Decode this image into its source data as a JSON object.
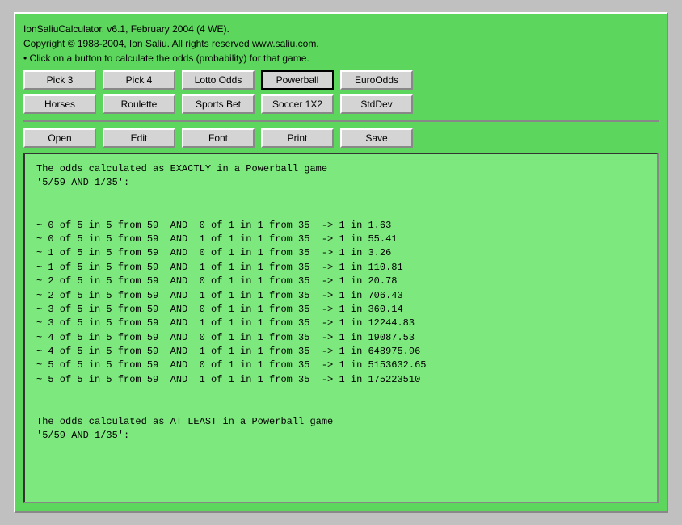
{
  "app": {
    "title_line1": "IonSaliuCalculator, v6.1, February 2004 (4 WE).",
    "title_line2": "Copyright © 1988-2004, Ion Saliu. All rights reserved www.saliu.com.",
    "title_line3": "• Click on a button to calculate the odds (probability) for that game."
  },
  "buttons": {
    "row1": [
      {
        "label": "Pick 3",
        "name": "pick3-button",
        "active": false
      },
      {
        "label": "Pick 4",
        "name": "pick4-button",
        "active": false
      },
      {
        "label": "Lotto Odds",
        "name": "lotto-odds-button",
        "active": false
      },
      {
        "label": "Powerball",
        "name": "powerball-button",
        "active": true
      },
      {
        "label": "EuroOdds",
        "name": "euro-odds-button",
        "active": false
      }
    ],
    "row2": [
      {
        "label": "Horses",
        "name": "horses-button",
        "active": false
      },
      {
        "label": "Roulette",
        "name": "roulette-button",
        "active": false
      },
      {
        "label": "Sports Bet",
        "name": "sports-bet-button",
        "active": false
      },
      {
        "label": "Soccer 1X2",
        "name": "soccer-button",
        "active": false
      },
      {
        "label": "StdDev",
        "name": "stddev-button",
        "active": false
      }
    ],
    "row3": [
      {
        "label": "Open",
        "name": "open-button",
        "active": false
      },
      {
        "label": "Edit",
        "name": "edit-button",
        "active": false
      },
      {
        "label": "Font",
        "name": "font-button",
        "active": false
      },
      {
        "label": "Print",
        "name": "print-button",
        "active": false
      },
      {
        "label": "Save",
        "name": "save-button",
        "active": false
      }
    ]
  },
  "output": {
    "content": "The odds calculated as EXACTLY in a Powerball game\n'5/59 AND 1/35':\n\n\n~ 0 of 5 in 5 from 59  AND  0 of 1 in 1 from 35  -> 1 in 1.63\n~ 0 of 5 in 5 from 59  AND  1 of 1 in 1 from 35  -> 1 in 55.41\n~ 1 of 5 in 5 from 59  AND  0 of 1 in 1 from 35  -> 1 in 3.26\n~ 1 of 5 in 5 from 59  AND  1 of 1 in 1 from 35  -> 1 in 110.81\n~ 2 of 5 in 5 from 59  AND  0 of 1 in 1 from 35  -> 1 in 20.78\n~ 2 of 5 in 5 from 59  AND  1 of 1 in 1 from 35  -> 1 in 706.43\n~ 3 of 5 in 5 from 59  AND  0 of 1 in 1 from 35  -> 1 in 360.14\n~ 3 of 5 in 5 from 59  AND  1 of 1 in 1 from 35  -> 1 in 12244.83\n~ 4 of 5 in 5 from 59  AND  0 of 1 in 1 from 35  -> 1 in 19087.53\n~ 4 of 5 in 5 from 59  AND  1 of 1 in 1 from 35  -> 1 in 648975.96\n~ 5 of 5 in 5 from 59  AND  0 of 1 in 1 from 35  -> 1 in 5153632.65\n~ 5 of 5 in 5 from 59  AND  1 of 1 in 1 from 35  -> 1 in 175223510\n\n\nThe odds calculated as AT LEAST in a Powerball game\n'5/59 AND 1/35':\n"
  }
}
